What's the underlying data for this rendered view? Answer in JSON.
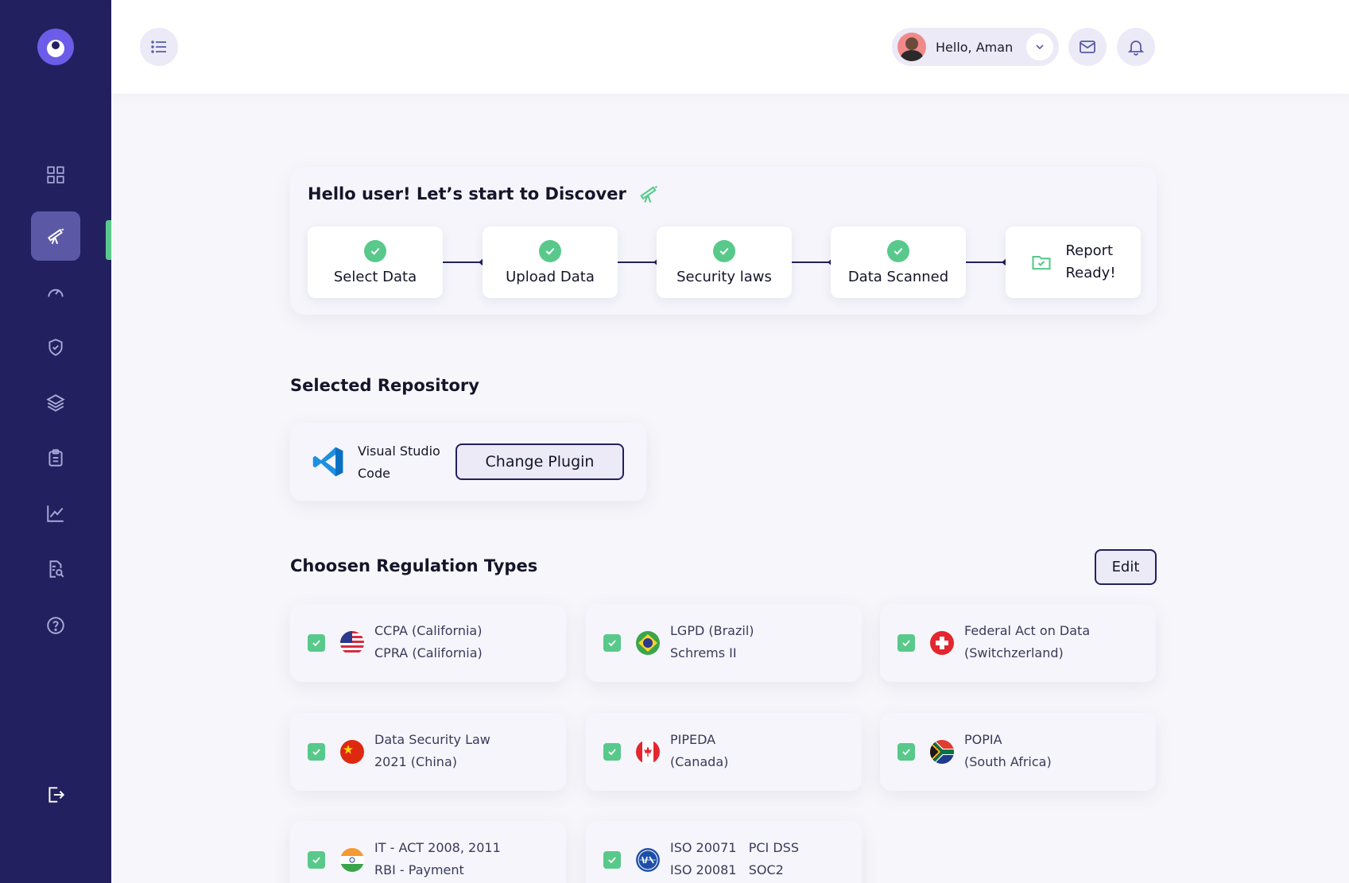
{
  "header": {
    "greeting": "Hello, Aman"
  },
  "progress": {
    "title": "Hello user! Let’s start to Discover",
    "steps": [
      {
        "label": "Select Data"
      },
      {
        "label": "Upload Data"
      },
      {
        "label": "Security laws"
      },
      {
        "label": "Data Scanned"
      }
    ],
    "final_step": {
      "line1": "Report",
      "line2": "Ready!"
    }
  },
  "repository": {
    "section_title": "Selected Repository",
    "name_line1": "Visual Studio",
    "name_line2": "Code",
    "change_button": "Change Plugin"
  },
  "regulations": {
    "section_title": "Choosen Regulation Types",
    "edit_button": "Edit",
    "items": [
      {
        "line1": "CCPA (California)",
        "line2": "CPRA (California)",
        "flag": "usa"
      },
      {
        "line1": "LGPD (Brazil)",
        "line2": "Schrems II",
        "flag": "brazil"
      },
      {
        "line1": "Federal Act on Data",
        "line2": "(Switchzerland)",
        "flag": "switzerland"
      },
      {
        "line1": "Data Security Law",
        "line2": "2021 (China)",
        "flag": "china"
      },
      {
        "line1": "PIPEDA",
        "line2": "(Canada)",
        "flag": "canada"
      },
      {
        "line1": "POPIA",
        "line2": "(South Africa)",
        "flag": "south-africa"
      },
      {
        "line1": "IT - ACT 2008, 2011",
        "line2": "RBI - Payment",
        "flag": "india"
      },
      {
        "line1": "ISO 20071   PCI DSS",
        "line2": "ISO 20081   SOC2",
        "flag": "iso"
      }
    ]
  },
  "colors": {
    "sidebar": "#23205f",
    "accent_green": "#58c98a",
    "background": "#f7f7fb"
  }
}
